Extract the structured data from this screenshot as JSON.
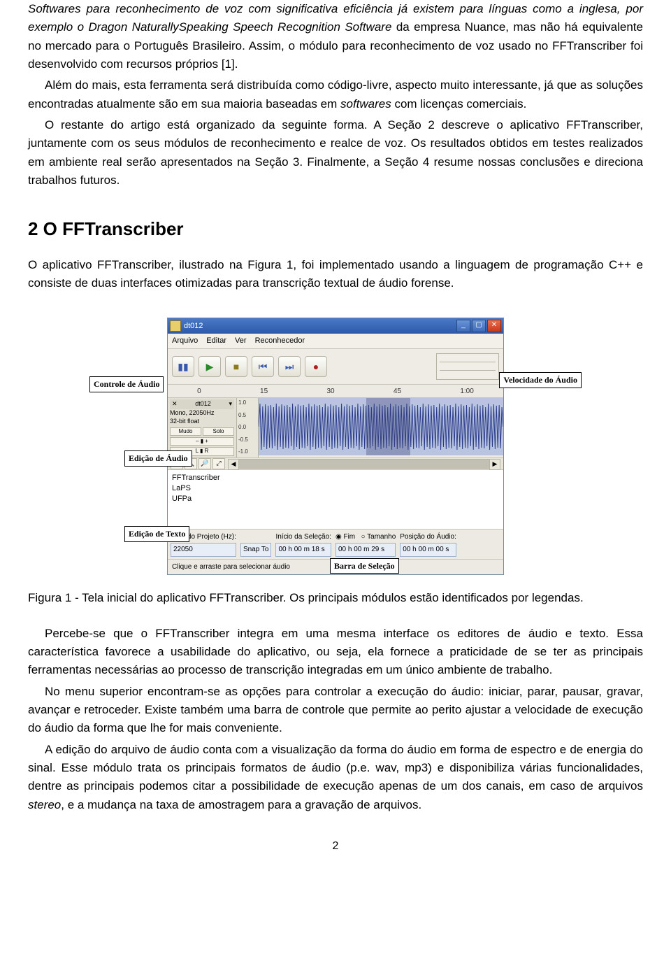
{
  "para1_a": "Softwares para reconhecimento de voz com significativa eficiência já existem para línguas como a inglesa, por exemplo o ",
  "para1_b": "Dragon NaturallySpeaking Speech Recognition Software",
  "para1_c": " da empresa Nuance, mas não há equivalente no mercado para o Português Brasileiro. Assim, o módulo para reconhecimento de voz usado no FFTranscriber foi desenvolvido com recursos próprios [1].",
  "para2_a": "Além do mais, esta ferramenta será distribuída como código-livre, aspecto muito interessante, já que as soluções encontradas atualmente são em sua maioria baseadas em ",
  "para2_b": "softwares",
  "para2_c": " com licenças comerciais.",
  "para3": "O restante do artigo está organizado da seguinte forma. A Seção 2 descreve o aplicativo FFTranscriber, juntamente com os seus módulos de reconhecimento e realce de voz. Os resultados obtidos em testes realizados em ambiente real serão apresentados na Seção 3. Finalmente, a Seção 4 resume nossas conclusões e direciona trabalhos futuros.",
  "section_heading": "2   O FFTranscriber",
  "para4": "O aplicativo FFTranscriber, ilustrado na Figura 1, foi implementado usando a linguagem de programação C++ e consiste de duas interfaces otimizadas para transcrição textual de áudio forense.",
  "app": {
    "title": "dt012",
    "menu": [
      "Arquivo",
      "Editar",
      "Ver",
      "Reconhecedor"
    ],
    "ruler": [
      "0",
      "15",
      "30",
      "45",
      "1:00"
    ],
    "track": {
      "name": "dt012",
      "line1": "Mono, 22050Hz",
      "line2": "32-bit float",
      "btn_mute": "Mudo",
      "btn_solo": "Solo"
    },
    "vscale": [
      "1.0",
      "0.5",
      "0.0",
      "-0.5",
      "-1.0"
    ],
    "text_lines": [
      "FFTranscriber",
      "LaPS",
      "UFPa"
    ],
    "status": {
      "rate_label": "Taxa do Projeto (Hz):",
      "rate_value": "22050",
      "snap": "Snap To",
      "sel_start_label": "Início da Seleção:",
      "sel_start": "00 h 00 m 18 s",
      "fim": "Fim",
      "tamanho": "Tamanho",
      "sel_end": "00 h 00 m 29 s",
      "pos_label": "Posição do Áudio:",
      "pos": "00 h 00 m 00 s"
    },
    "status2": "Clique e arraste para selecionar áudio"
  },
  "callouts": {
    "controle": "Controle de Áudio",
    "velocidade": "Velocidade do Áudio",
    "edicao_audio": "Edição de Áudio",
    "edicao_texto": "Edição de Texto",
    "barra": "Barra de Seleção"
  },
  "figure_caption": "Figura 1 - Tela inicial do aplicativo FFTranscriber. Os principais módulos estão identificados por legendas.",
  "para5": "Percebe-se que o FFTranscriber integra em uma mesma interface os editores de áudio e texto. Essa característica favorece a usabilidade do aplicativo, ou seja, ela fornece a praticidade de se ter as principais ferramentas necessárias ao processo de transcrição integradas em um único ambiente de trabalho.",
  "para6": "No menu superior encontram-se as opções para controlar a execução do áudio: iniciar, parar, pausar, gravar, avançar e retroceder. Existe também uma barra de controle que permite ao perito ajustar a velocidade de execução do áudio da forma que lhe for mais conveniente.",
  "para7_a": "A edição do arquivo de áudio conta com a visualização da forma do áudio em forma de espectro e de energia do sinal. Esse módulo trata os principais formatos de áudio (p.e. wav, mp3) e disponibiliza várias funcionalidades, dentre as principais podemos citar a possibilidade de execução apenas de um dos canais, em caso de arquivos ",
  "para7_b": "stereo",
  "para7_c": ", e a mudança na taxa de amostragem para a gravação de arquivos.",
  "page_number": "2"
}
